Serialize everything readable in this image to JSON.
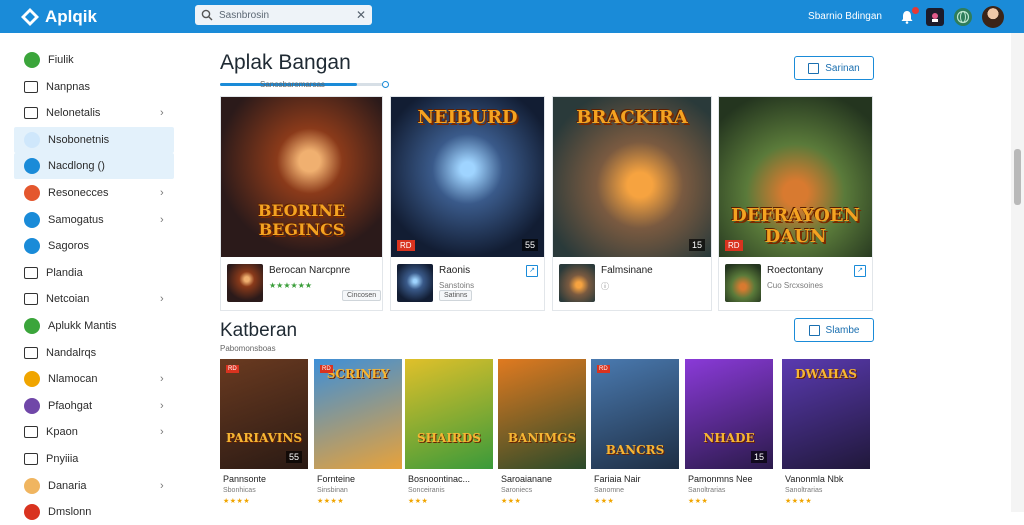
{
  "app": {
    "name": "Aplqik"
  },
  "search": {
    "value": "Sasnbrosin",
    "clear": "✕"
  },
  "user": {
    "name": "Sbarnio Bdingan"
  },
  "sidebar": {
    "items": [
      {
        "label": "Fiulik",
        "icon": "app-icon",
        "active": false,
        "chevron": false
      },
      {
        "label": "Nanpnas",
        "icon": "list-icon",
        "active": false,
        "chevron": false
      },
      {
        "label": "Nelonetalis",
        "icon": "grid-icon",
        "active": false,
        "chevron": true
      },
      {
        "label": "Nsobonetnis",
        "icon": "chat-icon",
        "active": true,
        "chevron": false
      },
      {
        "label": "Nacdlong ()",
        "icon": "bookmark-icon",
        "active": true,
        "chevron": false
      },
      {
        "label": "Resonecces",
        "icon": "fire-icon",
        "active": false,
        "chevron": true
      },
      {
        "label": "Samogatus",
        "icon": "shield-icon",
        "active": false,
        "chevron": true
      },
      {
        "label": "Sagoros",
        "icon": "globe-icon",
        "active": false,
        "chevron": false
      },
      {
        "label": "Plandia",
        "icon": "page-icon",
        "active": false,
        "chevron": false
      },
      {
        "label": "Netcoian",
        "icon": "folder-icon",
        "active": false,
        "chevron": true
      },
      {
        "label": "Aplukk Mantis",
        "icon": "leaf-icon",
        "active": false,
        "chevron": false
      },
      {
        "label": "Nandalrqs",
        "icon": "card-icon",
        "active": false,
        "chevron": false
      },
      {
        "label": "Nlamocan",
        "icon": "smile-icon",
        "active": false,
        "chevron": true
      },
      {
        "label": "Pfaohgat",
        "icon": "circle-icon",
        "active": false,
        "chevron": true
      },
      {
        "label": "Kpaon",
        "icon": "box-icon",
        "active": false,
        "chevron": true
      },
      {
        "label": "Pnyiiia",
        "icon": "doc-icon",
        "active": false,
        "chevron": false
      },
      {
        "label": "Danaria",
        "icon": "tag-icon",
        "active": false,
        "chevron": true
      },
      {
        "label": "Dmslonn",
        "icon": "gift-icon",
        "active": false,
        "chevron": false
      }
    ]
  },
  "section1": {
    "title": "Aplak Bangan",
    "subtitle": "Sanosbaremarsas",
    "button_label": "Sarinan",
    "slider_value": 0.83,
    "cards": [
      {
        "art": "BEORINE BEGINCS",
        "name": "Berocan Narcpnre",
        "meta": "★★★★★★",
        "chip": "Cincosen",
        "badge": "",
        "num": "",
        "corner": ""
      },
      {
        "art": "NEIBURD",
        "name": "Raonis",
        "meta": "Sanstoins",
        "chip": "Satinns",
        "badge": "RD",
        "num": "55",
        "corner": "↗"
      },
      {
        "art": "BRACKIRA",
        "name": "Falmsinane",
        "meta": "ⓘ",
        "chip": "",
        "badge": "",
        "num": "15",
        "corner": ""
      },
      {
        "art": "DEFRAYOEN DAUN",
        "name": "Roectontany",
        "meta": "Cuo Srcxsoines",
        "chip": "",
        "badge": "RD",
        "num": "",
        "corner": "↗"
      }
    ]
  },
  "section2": {
    "title": "Katberan",
    "subtitle": "Pabomonsboas",
    "button_label": "Slambe",
    "cards": [
      {
        "art": "PARIAVINS",
        "name": "Pannsonte",
        "meta": "Sbonhicas",
        "stars": "★★★★",
        "num": "55",
        "badge": "RD"
      },
      {
        "art": "SCRINEY",
        "name": "Fornteine",
        "meta": "Sinsbinan",
        "stars": "★★★★",
        "num": "",
        "badge": "RD"
      },
      {
        "art": "SHAIRDS",
        "name": "Bosnoontinac...",
        "meta": "Sonceiranis",
        "stars": "★★★",
        "num": "",
        "badge": ""
      },
      {
        "art": "BANIMGS",
        "name": "Saroaianane",
        "meta": "Saroniecs",
        "stars": "★★★",
        "num": "",
        "badge": ""
      },
      {
        "art": "BANCRS",
        "name": "Fariaia Nair",
        "meta": "Sanomne",
        "stars": "★★★",
        "num": "",
        "badge": "RD"
      },
      {
        "art": "NHADE",
        "name": "Pamonmns Nee",
        "meta": "Sanoltrarias",
        "stars": "★★★",
        "num": "15",
        "badge": ""
      },
      {
        "art": "DWAHAS",
        "name": "Vanonmla Nbk",
        "meta": "Sanoltrarias",
        "stars": "★★★★",
        "num": "",
        "badge": ""
      }
    ]
  },
  "colors": {
    "accent": "#1a8bd8",
    "topbar": "#1a8bd8",
    "active_bg": "#e3f1fb"
  }
}
